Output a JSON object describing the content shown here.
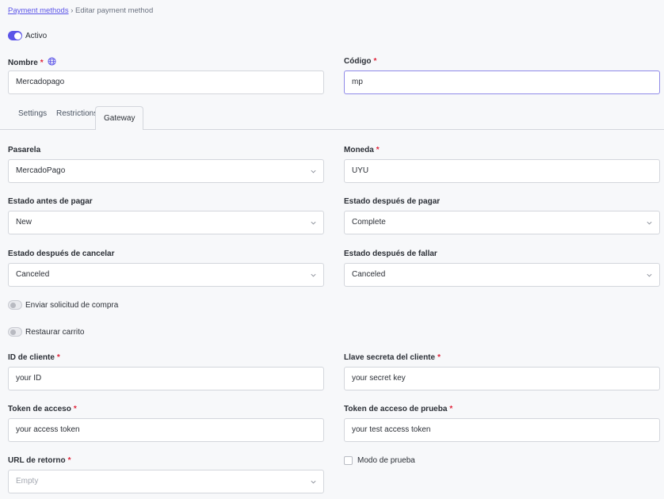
{
  "breadcrumb": {
    "link": "Payment methods",
    "separator": "›",
    "current": "Editar payment method"
  },
  "active_toggle": {
    "label": "Activo",
    "on": true
  },
  "nombre": {
    "label": "Nombre",
    "required": "*",
    "value": "Mercadopago",
    "icon": "globe-icon"
  },
  "codigo": {
    "label": "Código",
    "required": "*",
    "value": "mp"
  },
  "tabs": [
    {
      "label": "Settings"
    },
    {
      "label": "Restrictions"
    },
    {
      "label": "Gateway",
      "active": true
    }
  ],
  "pasarela": {
    "label": "Pasarela",
    "value": "MercadoPago"
  },
  "moneda": {
    "label": "Moneda",
    "required": "*",
    "value": "UYU"
  },
  "estado_antes": {
    "label": "Estado antes de pagar",
    "value": "New"
  },
  "estado_despues_pagar": {
    "label": "Estado después de pagar",
    "value": "Complete"
  },
  "estado_despues_cancelar": {
    "label": "Estado después de cancelar",
    "value": "Canceled"
  },
  "estado_despues_fallar": {
    "label": "Estado después de fallar",
    "value": "Canceled"
  },
  "enviar_solicitud": {
    "label": "Enviar solicitud de compra",
    "on": false
  },
  "restaurar_carrito": {
    "label": "Restaurar carrito",
    "on": false
  },
  "id_cliente": {
    "label": "ID de cliente",
    "required": "*",
    "value": "your ID"
  },
  "llave_secreta": {
    "label": "Llave secreta del cliente",
    "required": "*",
    "value": "your secret key"
  },
  "token_acceso": {
    "label": "Token de acceso",
    "required": "*",
    "value": "your access token"
  },
  "token_prueba": {
    "label": "Token de acceso de prueba",
    "required": "*",
    "value": "your test access token"
  },
  "url_retorno": {
    "label": "URL de retorno",
    "required": "*",
    "placeholder": "Empty"
  },
  "modo_prueba": {
    "label": "Modo de prueba",
    "checked": false
  },
  "colors": {
    "accent": "#5b54e8",
    "required": "#e0243a",
    "border": "#d3d6dc",
    "background": "#f7f8fa"
  }
}
